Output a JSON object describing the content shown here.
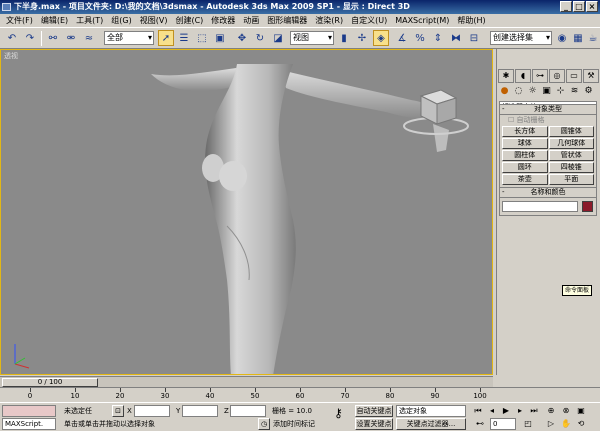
{
  "window": {
    "title": "下半身.max   - 项目文件夹: D:\\我的文档\\3dsmax   - Autodesk 3ds Max  2009 SP1   - 显示 : Direct 3D"
  },
  "menu": [
    "文件(F)",
    "编辑(E)",
    "工具(T)",
    "组(G)",
    "视图(V)",
    "创建(C)",
    "修改器",
    "动画",
    "图形编辑器",
    "渲染(R)",
    "自定义(U)",
    "MAXScript(M)",
    "帮助(H)"
  ],
  "toolbar": {
    "selection_filter": "全部",
    "ref_coord": "视图",
    "named_selection": "创建选择集",
    "icons": [
      "undo-icon",
      "redo-icon",
      "select-link-icon",
      "unlink-icon",
      "bind-spacewarp-icon",
      "select-object-icon",
      "select-region-icon",
      "select-by-name-icon",
      "window-crossing-icon",
      "move-icon",
      "rotate-icon",
      "scale-icon",
      "pivot-icon",
      "manipulate-icon",
      "snap-icon",
      "angle-snap-icon",
      "percent-snap-icon",
      "spinner-snap-icon",
      "mirror-icon",
      "align-icon",
      "layer-icon",
      "curve-editor-icon",
      "schematic-icon",
      "material-editor-icon",
      "render-setup-icon",
      "render-frame-icon",
      "quick-render-icon"
    ]
  },
  "viewport": {
    "label": "透视"
  },
  "command_panel": {
    "category_dropdown": "标准基本体",
    "rollout_object_type": {
      "title": "对象类型",
      "autogrid_label": "自动栅格",
      "buttons": [
        "长方体",
        "圆锥体",
        "球体",
        "几何球体",
        "圆柱体",
        "管状体",
        "圆环",
        "四棱锥",
        "茶壶",
        "平面"
      ]
    },
    "rollout_name_color": {
      "title": "名称和颜色"
    },
    "tooltip": "命令面板",
    "accent_color": "#8b1a2a"
  },
  "timeline": {
    "slider_label": "0 / 100",
    "ticks": [
      "0",
      "10",
      "20",
      "30",
      "40",
      "50",
      "60",
      "70",
      "80",
      "90",
      "100"
    ]
  },
  "statusbar": {
    "maxscript_label": "MAXScript.",
    "selection_status": "未选定任",
    "x_label": "X",
    "y_label": "Y",
    "z_label": "Z",
    "grid_label": "栅格 = 10.0",
    "auto_key": "自动关键点",
    "set_key": "设置关键点",
    "selected_object": "选定对象",
    "key_filters": "关键点过滤器...",
    "prompt": "单击或单击并拖动以选择对象",
    "add_time_tag": "添加时间标记",
    "frame": "0"
  }
}
